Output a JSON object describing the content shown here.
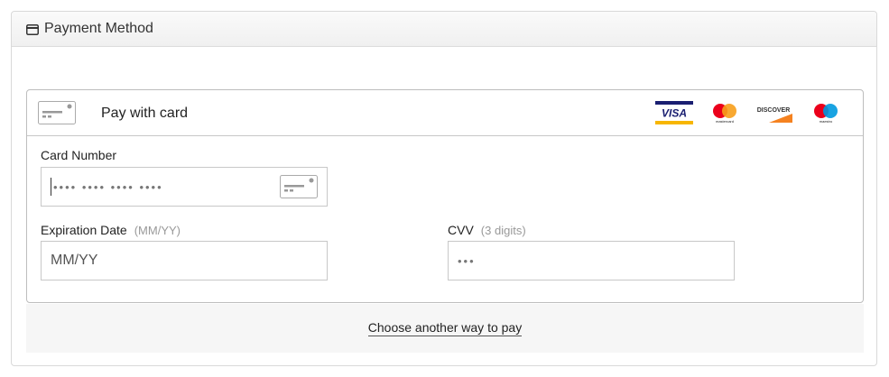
{
  "header": {
    "icon": "credit-card-icon",
    "title": "Payment Method"
  },
  "card_section": {
    "title": "Pay with card",
    "icon": "credit-card-icon",
    "brands": [
      {
        "name": "visa-logo",
        "text": "VISA"
      },
      {
        "name": "mastercard-logo",
        "text": "mastercard"
      },
      {
        "name": "discover-logo",
        "text": "DISCOVER"
      },
      {
        "name": "maestro-logo",
        "text": "maestro"
      }
    ]
  },
  "fields": {
    "card_number": {
      "label": "Card Number",
      "placeholder": "•••• •••• •••• ••••"
    },
    "expiration": {
      "label": "Expiration Date",
      "hint": "(MM/YY)",
      "placeholder": "MM/YY"
    },
    "cvv": {
      "label": "CVV",
      "hint": "(3 digits)",
      "placeholder": "•••"
    }
  },
  "footer": {
    "link_label": "Choose another way to pay"
  },
  "colors": {
    "visa_blue": "#1a1f71",
    "visa_gold": "#f7b600",
    "mastercard_red": "#eb001b",
    "mastercard_orange": "#f79e1b",
    "maestro_blue": "#0099df",
    "discover_orange": "#f58220"
  }
}
